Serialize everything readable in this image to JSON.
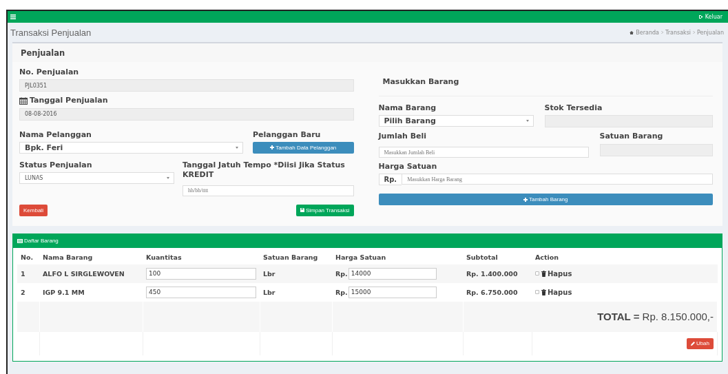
{
  "topbar": {
    "logout": "Keluar"
  },
  "page_title": "Transaksi Penjualan",
  "breadcrumb": [
    "Beranda",
    "Transaksi",
    "Penjualan"
  ],
  "sale": {
    "title": "Penjualan",
    "no_label": "No. Penjualan",
    "no_value": "PJL0351",
    "date_label": "Tanggal Penjualan",
    "date_value": "08-08-2016",
    "customer_label": "Nama Pelanggan",
    "customer_value": "Bpk. Feri",
    "new_customer_label": "Pelanggan Baru",
    "new_customer_button": "Tambah Data Pelanggan",
    "status_label": "Status Penjualan",
    "status_value": "LUNAS",
    "due_label": "Tanggal Jatuh Tempo *Diisi Jika Status KREDIT",
    "due_placeholder": "hh/bb/tttt",
    "back_button": "Kembali",
    "save_button": "Simpan Transaksi"
  },
  "item_form": {
    "title": "Masukkan Barang",
    "name_label": "Nama Barang",
    "name_value": "Pilih Barang",
    "stock_label": "Stok Tersedia",
    "qty_label": "Jumlah Beli",
    "qty_placeholder": "Masukkan Jumlah Beli",
    "unit_label": "Satuan Barang",
    "price_label": "Harga Satuan",
    "price_prefix": "Rp.",
    "price_placeholder": "Masukkan Harga Barang",
    "add_button": "Tambah Barang"
  },
  "items": {
    "title": "Daftar Barang",
    "columns": [
      "No.",
      "Nama Barang",
      "Kuantitas",
      "Satuan Barang",
      "Harga Satuan",
      "Subtotal",
      "Action"
    ],
    "rows": [
      {
        "no": "1",
        "name": "ALFO L SIRGLEWOVEN",
        "qty": "100",
        "unit": "Lbr",
        "price_prefix": "Rp.",
        "price": "14000",
        "subtotal": "Rp. 1.400.000",
        "checked": false,
        "action": "Hapus"
      },
      {
        "no": "2",
        "name": "IGP 9.1 MM",
        "qty": "450",
        "unit": "Lbr",
        "price_prefix": "Rp.",
        "price": "15000",
        "subtotal": "Rp. 6.750.000",
        "checked": false,
        "action": "Hapus"
      }
    ],
    "total": "**TOTAL =** Rp. 8.150.000,-",
    "edit_button": "Ubah"
  }
}
